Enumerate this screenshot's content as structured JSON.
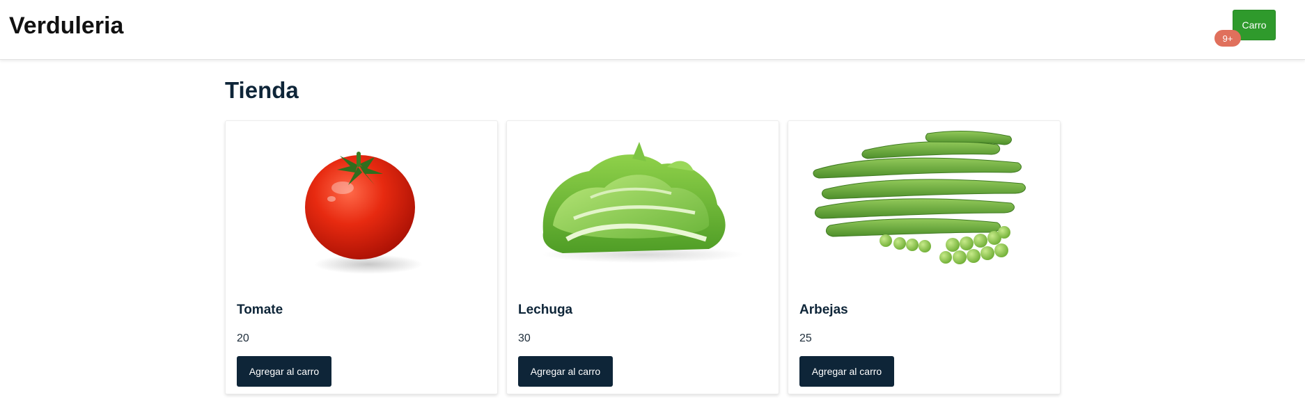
{
  "header": {
    "brand": "Verduleria",
    "cart_label": "Carro",
    "cart_badge": "9+"
  },
  "main": {
    "title": "Tienda",
    "products": [
      {
        "name": "Tomate",
        "price": "20",
        "button_label": "Agregar al carro",
        "image": "tomato-image"
      },
      {
        "name": "Lechuga",
        "price": "30",
        "button_label": "Agregar al carro",
        "image": "lettuce-image"
      },
      {
        "name": "Arbejas",
        "price": "25",
        "button_label": "Agregar al carro",
        "image": "peas-image"
      }
    ]
  },
  "colors": {
    "primary_navy": "#0e2538",
    "cart_green": "#2f9a2c",
    "badge_red": "#e0705c"
  }
}
